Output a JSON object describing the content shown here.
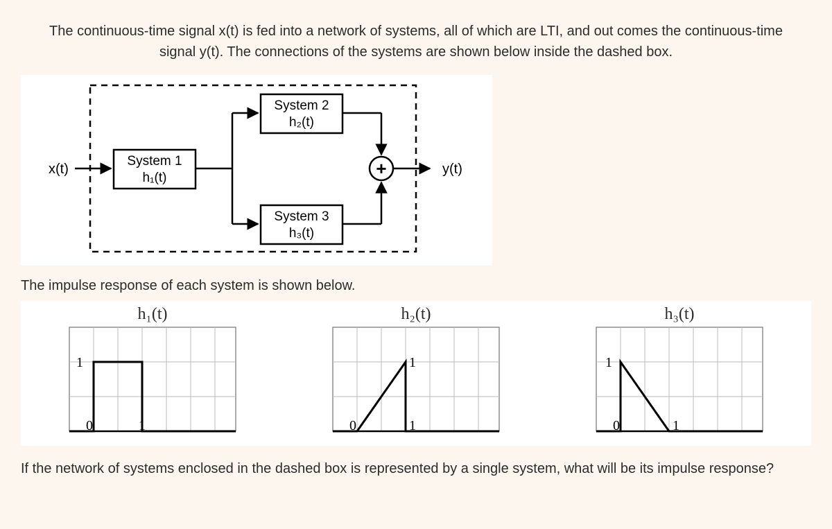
{
  "prompt_line1": "The continuous-time signal x(t) is fed into a network of systems, all of which are LTI, and out comes the continuous-time",
  "prompt_line2": "signal y(t). The connections of the systems are shown below inside the dashed box.",
  "subtext": "The impulse response of each system is shown below.",
  "question": "If the network of systems enclosed in the dashed box is represented by a single system, what will be its impulse response?",
  "diagram": {
    "input_label": "x(t)",
    "output_label": "y(t)",
    "sys1_name": "System 1",
    "sys1_func": "h₁(t)",
    "sys2_name": "System 2",
    "sys2_func": "h₂(t)",
    "sys3_name": "System 3",
    "sys3_func": "h₃(t)",
    "sum_symbol": "+"
  },
  "plots": {
    "h1_title": "h₁(t)",
    "h2_title": "h₂(t)",
    "h3_title": "h₃(t)",
    "tick0": "0",
    "tick1": "1",
    "ytick1": "1"
  },
  "chart_data": [
    {
      "type": "line",
      "title": "h₁(t)",
      "x": [
        0,
        0,
        1,
        1
      ],
      "y": [
        0,
        1,
        1,
        0
      ],
      "xlabel": "",
      "ylabel": "",
      "xlim": [
        -0.5,
        3
      ],
      "ylim": [
        0,
        1.6
      ]
    },
    {
      "type": "line",
      "title": "h₂(t)",
      "x": [
        0,
        1,
        1
      ],
      "y": [
        0,
        1,
        0
      ],
      "xlabel": "",
      "ylabel": "",
      "xlim": [
        -0.5,
        3
      ],
      "ylim": [
        0,
        1.6
      ]
    },
    {
      "type": "line",
      "title": "h₃(t)",
      "x": [
        0,
        0,
        1
      ],
      "y": [
        0,
        1,
        0
      ],
      "xlabel": "",
      "ylabel": "",
      "xlim": [
        -0.5,
        3
      ],
      "ylim": [
        0,
        1.6
      ]
    }
  ]
}
